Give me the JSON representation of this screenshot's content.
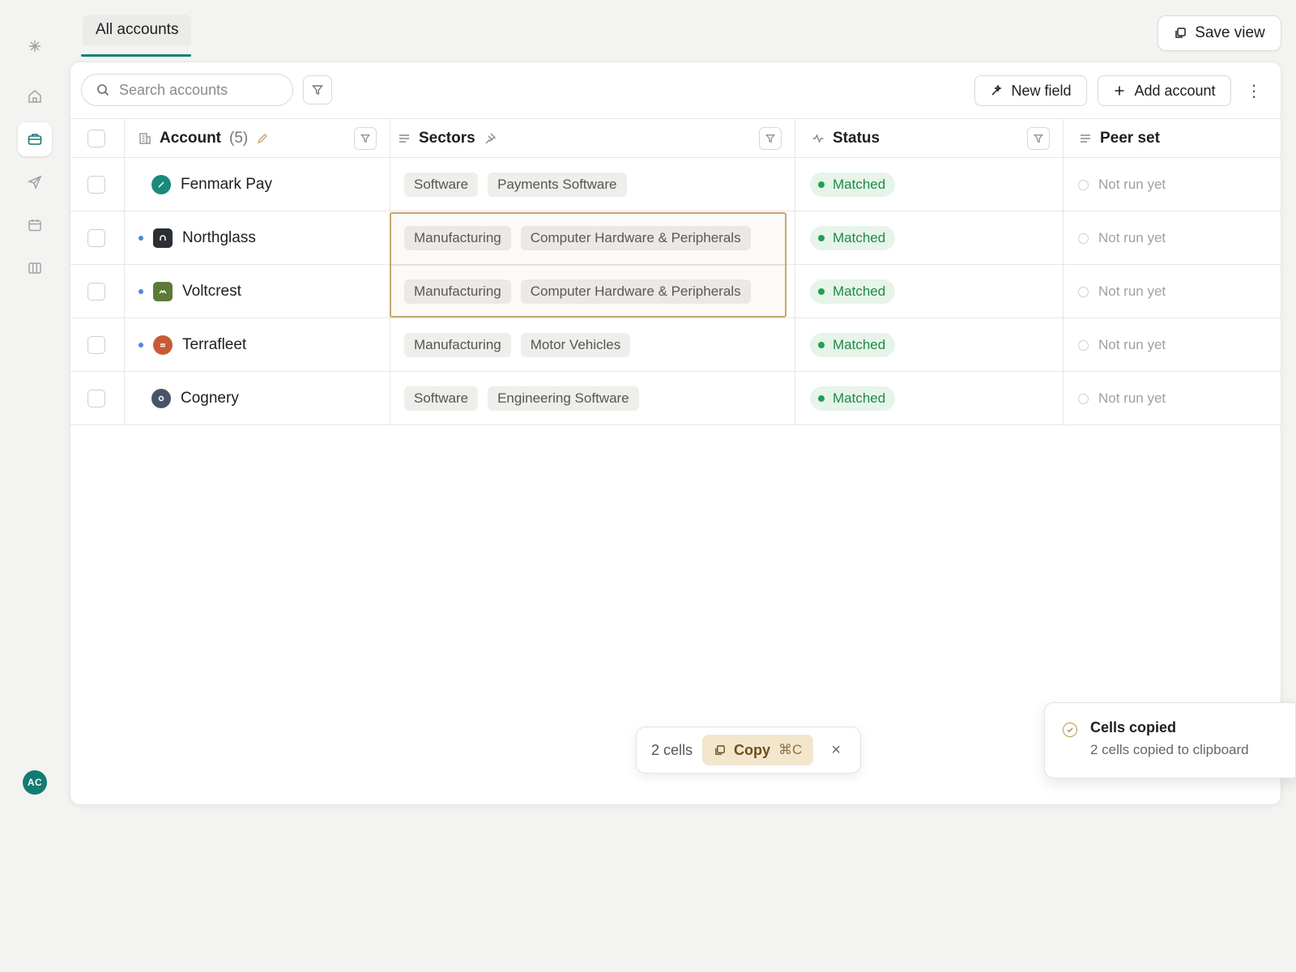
{
  "tab": {
    "label": "All accounts"
  },
  "header": {
    "save_view_label": "Save view"
  },
  "toolbar": {
    "search_placeholder": "Search accounts",
    "new_field_label": "New field",
    "add_account_label": "Add account"
  },
  "columns": {
    "account": {
      "label": "Account",
      "count": "(5)"
    },
    "sectors": {
      "label": "Sectors"
    },
    "status": {
      "label": "Status"
    },
    "peer_set": {
      "label": "Peer set"
    }
  },
  "rows": [
    {
      "name": "Fenmark Pay",
      "logo_color": "#1a8a7c",
      "logo_shape": "circle",
      "unread": false,
      "sectors": [
        "Software",
        "Payments Software"
      ],
      "status": "Matched",
      "peer_set": "Not run yet"
    },
    {
      "name": "Northglass",
      "logo_color": "#2b2f33",
      "logo_shape": "square",
      "unread": true,
      "sectors": [
        "Manufacturing",
        "Computer Hardware & Peripherals"
      ],
      "status": "Matched",
      "peer_set": "Not run yet"
    },
    {
      "name": "Voltcrest",
      "logo_color": "#5e7a3a",
      "logo_shape": "square",
      "unread": true,
      "sectors": [
        "Manufacturing",
        "Computer Hardware & Peripherals"
      ],
      "status": "Matched",
      "peer_set": "Not run yet"
    },
    {
      "name": "Terrafleet",
      "logo_color": "#c95a38",
      "logo_shape": "circle",
      "unread": true,
      "sectors": [
        "Manufacturing",
        "Motor Vehicles"
      ],
      "status": "Matched",
      "peer_set": "Not run yet"
    },
    {
      "name": "Cognery",
      "logo_color": "#4a5468",
      "logo_shape": "circle",
      "unread": false,
      "sectors": [
        "Software",
        "Engineering Software"
      ],
      "status": "Matched",
      "peer_set": "Not run yet"
    }
  ],
  "copybar": {
    "count_label": "2 cells",
    "copy_label": "Copy",
    "shortcut": "⌘C",
    "close_glyph": "×"
  },
  "toast": {
    "title": "Cells copied",
    "message": "2 cells copied to clipboard"
  },
  "user": {
    "initials": "AC"
  },
  "colors": {
    "accent": "#17807a",
    "matched": "#1f8a46",
    "selection": "#c8a66e"
  },
  "icons": {
    "sidebar": [
      "sparkle-icon",
      "home-icon",
      "briefcase-icon",
      "send-icon",
      "calendar-icon",
      "columns-icon"
    ],
    "toolbar": [
      "search-icon",
      "filter-icon",
      "wand-icon",
      "plus-icon",
      "more-vertical-icon"
    ]
  }
}
